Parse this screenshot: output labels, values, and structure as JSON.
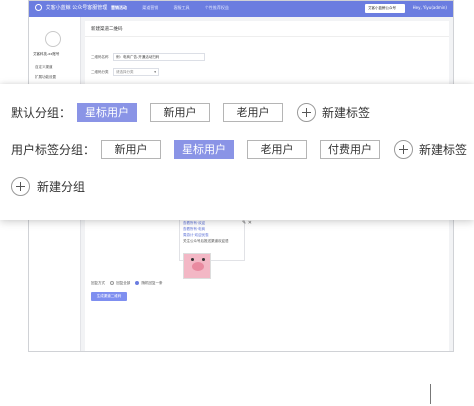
{
  "background": {
    "topbar": {
      "logo": "艾客小蓝鲸",
      "subtitle": "公众号客服管理",
      "nav": [
        "营销活动",
        "渠道营销",
        "客服工具",
        "个性推荐权益"
      ],
      "active_nav_index": 0,
      "account_select": "艾客小蓝鲸公众号",
      "user": "Hey, Yiyu(admin)"
    },
    "sidebar": {
      "account_name": "艾客科技-xx账号",
      "items": [
        "自定义渠道",
        "扩展功能设置"
      ]
    },
    "content": {
      "title": "新建渠道二维码",
      "name_label": "二维码名称",
      "name_value": "例：电商广告-开通活动扫码",
      "type_label": "二维码分类",
      "type_placeholder": "请选择分类",
      "msg_links": [
        "查看所有·欢迎",
        "查看所有·电商",
        "周游计·欢迎优惠"
      ],
      "msg_text": "关注公众号后推送渠道欢迎语",
      "radio_label": "回复方式",
      "radio_options": [
        "回复全部",
        "随机回复一条"
      ],
      "save_button": "生成渠道二维码"
    }
  },
  "overlay": {
    "default_group": {
      "label": "默认分组：",
      "tags": [
        "星标用户",
        "新用户",
        "老用户"
      ],
      "active_index": 0,
      "add_tag": "新建标签"
    },
    "user_tag_group": {
      "label": "用户标签分组：",
      "tags": [
        "新用户",
        "星标用户",
        "老用户",
        "付费用户"
      ],
      "active_index": 1,
      "add_tag": "新建标签"
    },
    "add_group": "新建分组"
  },
  "colors": {
    "accent": "#8a94e6",
    "topbar": "#6b7de0"
  }
}
